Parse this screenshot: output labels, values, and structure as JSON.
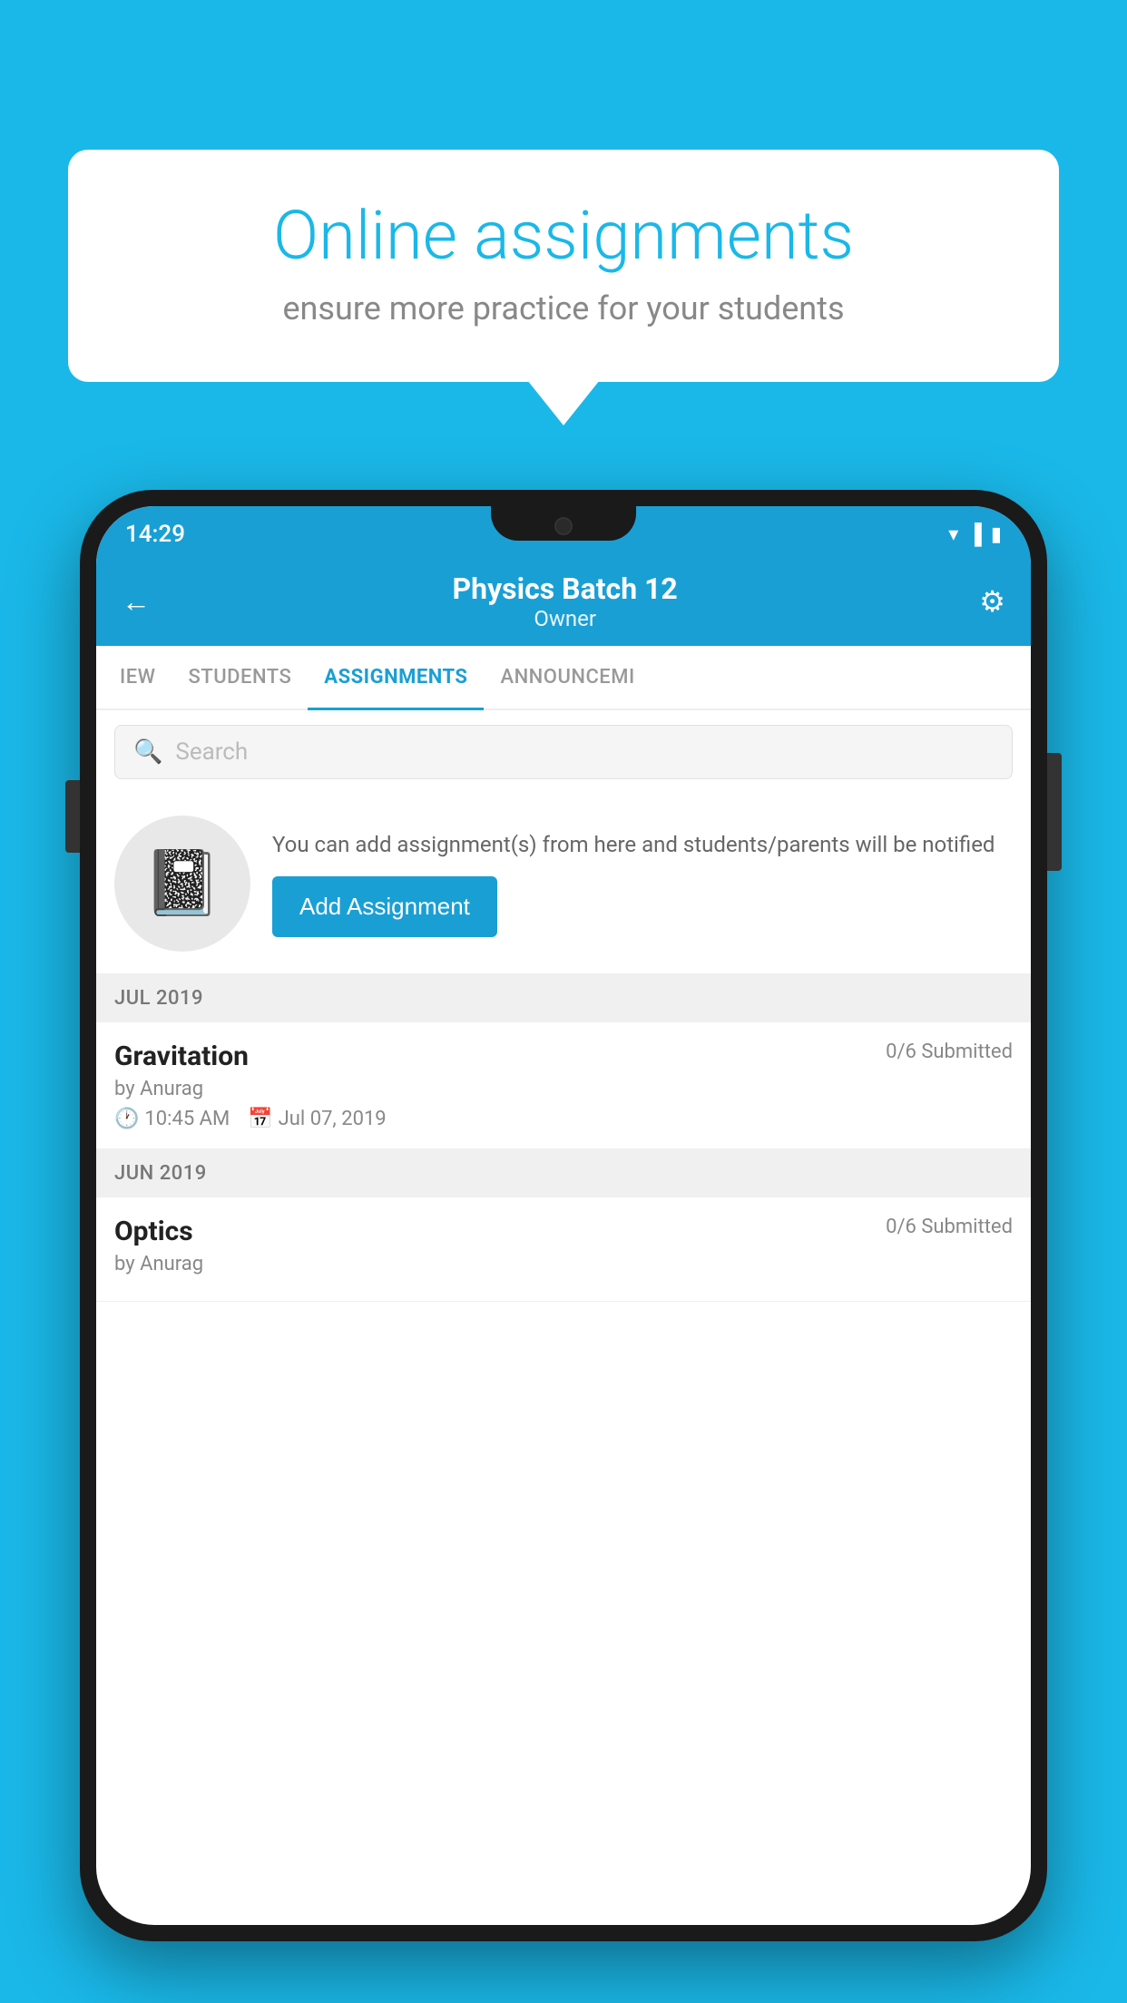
{
  "background_color": "#1ab8e8",
  "speech_bubble": {
    "title": "Online assignments",
    "subtitle": "ensure more practice for your students"
  },
  "phone": {
    "status_bar": {
      "time": "14:29"
    },
    "header": {
      "title": "Physics Batch 12",
      "subtitle": "Owner",
      "back_label": "←",
      "settings_label": "⚙"
    },
    "tabs": [
      {
        "label": "IEW",
        "active": false
      },
      {
        "label": "STUDENTS",
        "active": false
      },
      {
        "label": "ASSIGNMENTS",
        "active": true
      },
      {
        "label": "ANNOUNCEMI",
        "active": false
      }
    ],
    "search": {
      "placeholder": "Search"
    },
    "info_card": {
      "description": "You can add assignment(s) from here and students/parents will be notified",
      "button_label": "Add Assignment"
    },
    "sections": [
      {
        "month_label": "JUL 2019",
        "assignments": [
          {
            "name": "Gravitation",
            "submitted": "0/6 Submitted",
            "author": "by Anurag",
            "time": "10:45 AM",
            "date": "Jul 07, 2019"
          }
        ]
      },
      {
        "month_label": "JUN 2019",
        "assignments": [
          {
            "name": "Optics",
            "submitted": "0/6 Submitted",
            "author": "by Anurag",
            "time": "",
            "date": ""
          }
        ]
      }
    ]
  }
}
